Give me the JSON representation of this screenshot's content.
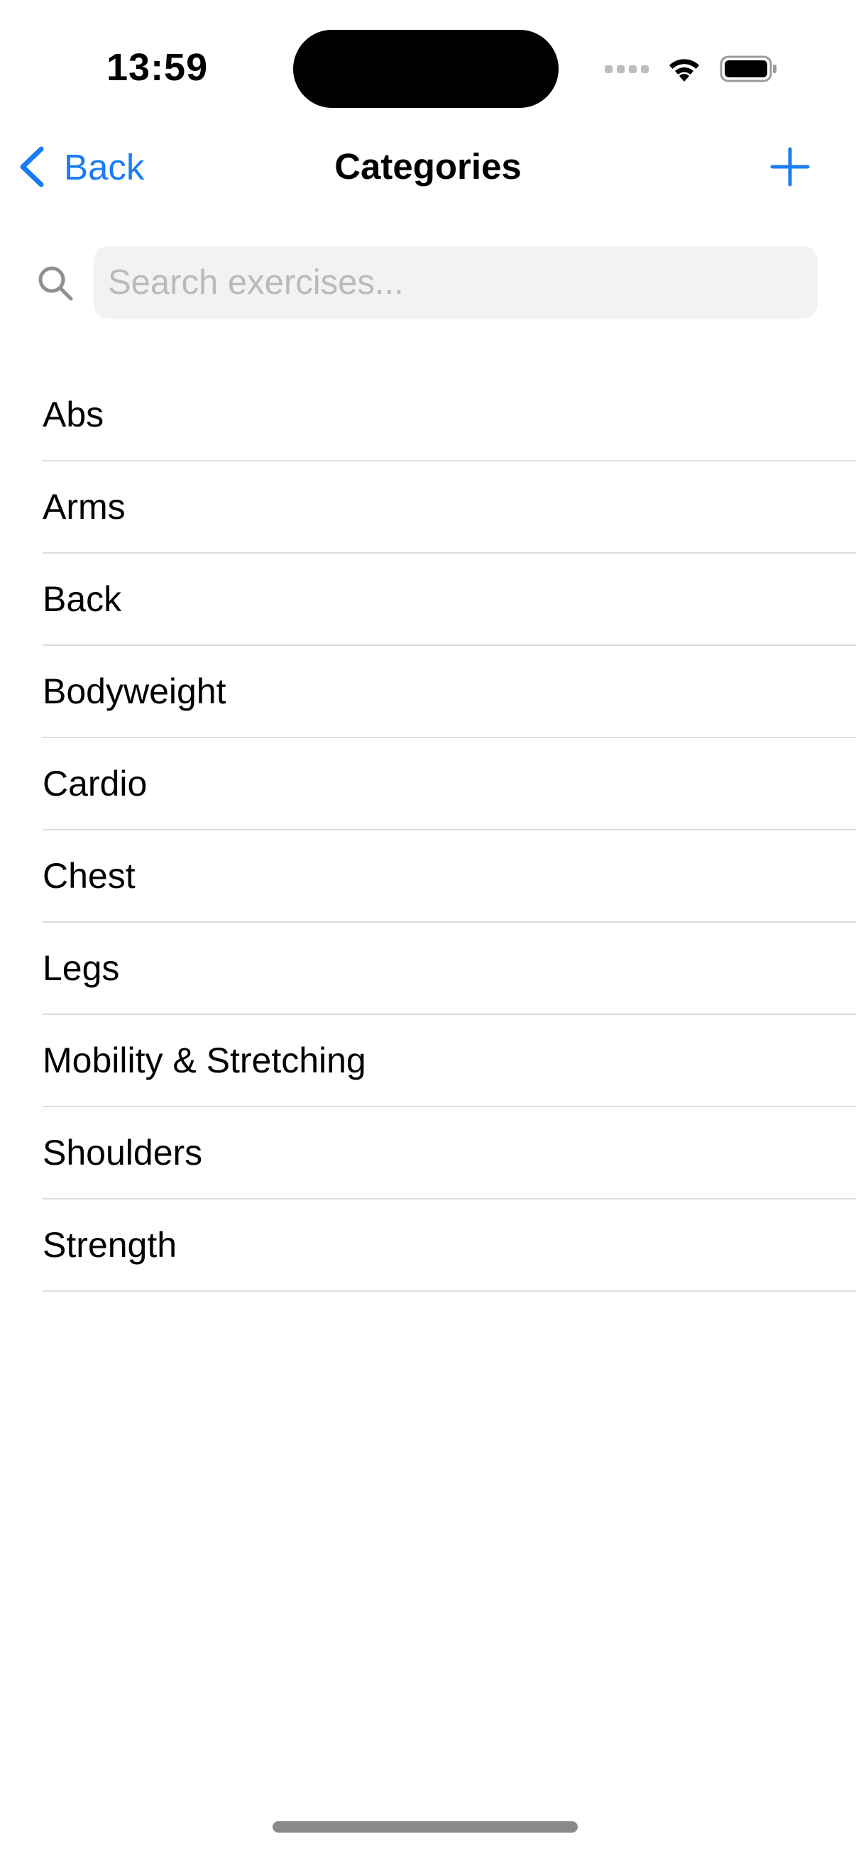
{
  "status_bar": {
    "time": "13:59"
  },
  "nav": {
    "back_label": "Back",
    "title": "Categories",
    "add_icon": "plus-icon",
    "accent_color": "#1a7cf5"
  },
  "search": {
    "placeholder": "Search exercises...",
    "value": ""
  },
  "categories": [
    {
      "label": "Abs"
    },
    {
      "label": "Arms"
    },
    {
      "label": "Back"
    },
    {
      "label": "Bodyweight"
    },
    {
      "label": "Cardio"
    },
    {
      "label": "Chest"
    },
    {
      "label": "Legs"
    },
    {
      "label": "Mobility & Stretching"
    },
    {
      "label": "Shoulders"
    },
    {
      "label": "Strength"
    }
  ]
}
